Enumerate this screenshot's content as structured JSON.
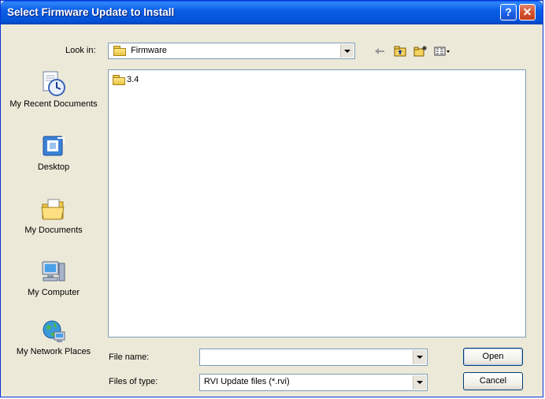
{
  "window": {
    "title": "Select Firmware Update to Install",
    "help_glyph": "?",
    "close_glyph": "✕"
  },
  "lookin": {
    "label": "Look in:",
    "value": "Firmware"
  },
  "toolbar": {
    "icons": [
      "back-arrow-icon",
      "up-folder-icon",
      "new-folder-icon",
      "view-menu-icon"
    ]
  },
  "places": [
    {
      "label": "My Recent Documents",
      "icon": "recent-documents-icon"
    },
    {
      "label": "Desktop",
      "icon": "desktop-icon"
    },
    {
      "label": "My Documents",
      "icon": "my-documents-icon"
    },
    {
      "label": "My Computer",
      "icon": "my-computer-icon"
    },
    {
      "label": "My Network Places",
      "icon": "network-places-icon"
    }
  ],
  "files": [
    {
      "name": "3.4",
      "type": "folder"
    }
  ],
  "filename": {
    "label": "File name:",
    "value": ""
  },
  "filetype": {
    "label": "Files of type:",
    "value": "RVI Update files (*.rvi)"
  },
  "buttons": {
    "open": "Open",
    "cancel": "Cancel"
  }
}
